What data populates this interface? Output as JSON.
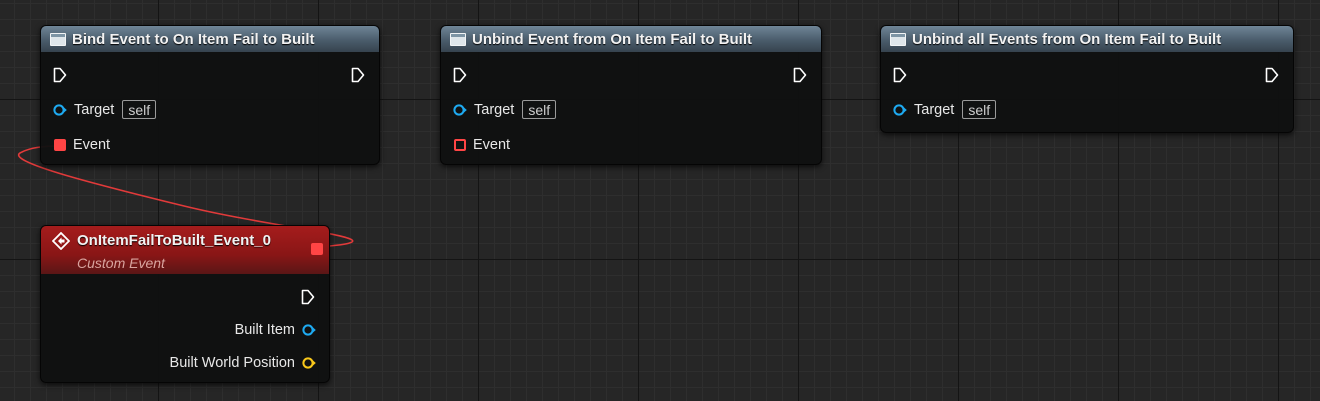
{
  "nodes": {
    "bind": {
      "title": "Bind Event to On Item Fail to Built",
      "target_label": "Target",
      "target_default": "self",
      "event_label": "Event"
    },
    "unbind": {
      "title": "Unbind Event from On Item Fail to Built",
      "target_label": "Target",
      "target_default": "self",
      "event_label": "Event"
    },
    "unbind_all": {
      "title": "Unbind all Events from On Item Fail to Built",
      "target_label": "Target",
      "target_default": "self"
    },
    "custom_event": {
      "title": "OnItemFailToBuilt_Event_0",
      "subtitle": "Custom Event",
      "outputs": [
        {
          "label": "Built Item",
          "pin_type": "object"
        },
        {
          "label": "Built World Position",
          "pin_type": "vector"
        }
      ]
    }
  },
  "colors": {
    "exec_pin": "#ffffff",
    "object_pin": "#1eaaf1",
    "vector_pin": "#f9c81a",
    "delegate_pin": "#ff4545",
    "delegate_wire": "#ff4545",
    "event_header": "#a51c1c",
    "function_header": "#5b7183"
  }
}
